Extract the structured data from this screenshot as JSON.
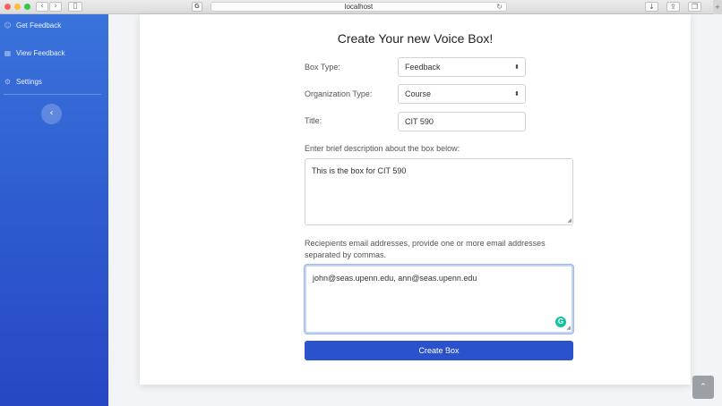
{
  "browser": {
    "url": "localhost",
    "back_icon": "chevron-left-icon",
    "forward_icon": "chevron-right-icon"
  },
  "sidebar": {
    "items": [
      {
        "label": "Get Feedback",
        "icon": "chat-icon"
      },
      {
        "label": "View Feedback",
        "icon": "table-icon"
      },
      {
        "label": "Settings",
        "icon": "gear-icon"
      }
    ],
    "collapse_icon": "chevron-left-icon"
  },
  "form": {
    "title": "Create Your new Voice Box!",
    "box_type": {
      "label": "Box Type:",
      "value": "Feedback"
    },
    "org_type": {
      "label": "Organization Type:",
      "value": "Course"
    },
    "title_field": {
      "label": "Title:",
      "value": "CIT 590"
    },
    "description": {
      "label": "Enter brief description about the box below:",
      "value": "This is the box for CIT 590"
    },
    "recipients": {
      "label_line1": "Reciepients email addresses, provide one or more email addresses",
      "label_line2": "separated by commas.",
      "value": "john@seas.upenn.edu, ann@seas.upenn.edu"
    },
    "submit_label": "Create Box"
  },
  "colors": {
    "sidebar_top": "#3a73db",
    "sidebar_bottom": "#2747c4",
    "primary_button": "#2a52cc",
    "grammarly": "#15c39a"
  }
}
